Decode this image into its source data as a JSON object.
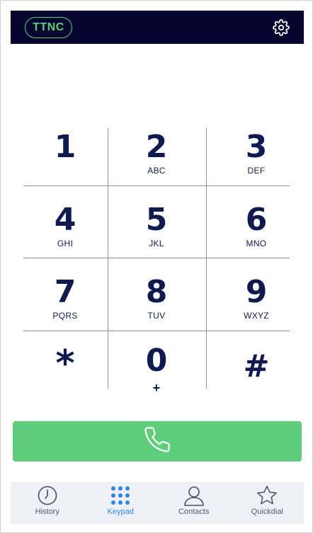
{
  "header": {
    "brand": "TTNC",
    "settings_icon": "gear-icon",
    "background": "#050530",
    "accent": "#5fd07a"
  },
  "keypad": {
    "keys": [
      {
        "digit": "1",
        "letters": ""
      },
      {
        "digit": "2",
        "letters": "ABC"
      },
      {
        "digit": "3",
        "letters": "DEF"
      },
      {
        "digit": "4",
        "letters": "GHI"
      },
      {
        "digit": "5",
        "letters": "JKL"
      },
      {
        "digit": "6",
        "letters": "MNO"
      },
      {
        "digit": "7",
        "letters": "PQRS"
      },
      {
        "digit": "8",
        "letters": "TUV"
      },
      {
        "digit": "9",
        "letters": "WXYZ"
      },
      {
        "digit": "*",
        "letters": ""
      },
      {
        "digit": "0",
        "letters": "+"
      },
      {
        "digit": "#",
        "letters": ""
      }
    ],
    "text_color": "#0f1a4f"
  },
  "call_button": {
    "icon": "phone-icon",
    "color": "#5fce7c"
  },
  "tabbar": {
    "tabs": [
      {
        "label": "History",
        "icon": "clock-icon",
        "active": false
      },
      {
        "label": "Keypad",
        "icon": "keypad-grid-icon",
        "active": true
      },
      {
        "label": "Contacts",
        "icon": "person-icon",
        "active": false
      },
      {
        "label": "Quickdial",
        "icon": "star-icon",
        "active": false
      }
    ],
    "active_color": "#2f86e8"
  }
}
